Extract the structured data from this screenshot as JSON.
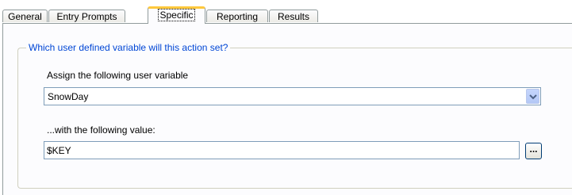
{
  "tabs": [
    {
      "label": "General"
    },
    {
      "label": "Entry Prompts"
    },
    {
      "label": "Specific"
    },
    {
      "label": "Reporting"
    },
    {
      "label": "Results"
    }
  ],
  "active_tab": "Specific",
  "group": {
    "title": "Which user defined variable will this action set?"
  },
  "variable": {
    "label": "Assign the following user variable",
    "value": "SnowDay"
  },
  "value_field": {
    "label": "...with the following value:",
    "value": "$KEY"
  },
  "browse_button": {
    "label": "..."
  },
  "icons": {
    "dropdown": "chevron-down-icon"
  },
  "colors": {
    "group_title": "#0046d5",
    "active_tab_accent": "#ffc83c",
    "field_border": "#7f9db9"
  }
}
